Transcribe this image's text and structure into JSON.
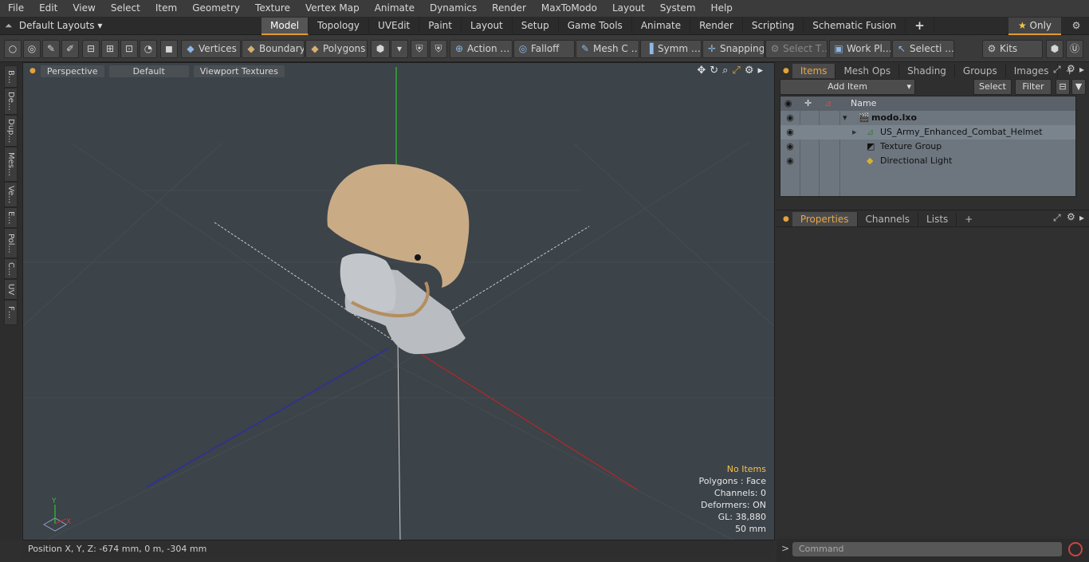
{
  "menu": [
    "File",
    "Edit",
    "View",
    "Select",
    "Item",
    "Geometry",
    "Texture",
    "Vertex Map",
    "Animate",
    "Dynamics",
    "Render",
    "MaxToModo",
    "Layout",
    "System",
    "Help"
  ],
  "layout_selector": "Default Layouts",
  "tabs": [
    "Model",
    "Topology",
    "UVEdit",
    "Paint",
    "Layout",
    "Setup",
    "Game Tools",
    "Animate",
    "Render",
    "Scripting",
    "Schematic Fusion"
  ],
  "active_tab": "Model",
  "only_label": "Only",
  "toolbar": {
    "vertices": "Vertices",
    "boundary": "Boundary",
    "polygons": "Polygons",
    "action": "Action …",
    "falloff": "Falloff",
    "mesh": "Mesh C …",
    "symm": "Symm …",
    "snapping": "Snapping",
    "select_t": "Select T…",
    "work_plane": "Work Pl…",
    "selection": "Selecti …",
    "kits": "Kits"
  },
  "left_tabs": [
    "B…",
    "De…",
    "Dup…",
    "Mes…",
    "Ve…",
    "E…",
    "Pol…",
    "C…",
    "UV",
    "F…"
  ],
  "viewport": {
    "view_mode": "Perspective",
    "shading": "Default",
    "textures": "Viewport Textures",
    "info": {
      "no_items": "No Items",
      "polygons": "Polygons : Face",
      "channels": "Channels: 0",
      "deformers": "Deformers: ON",
      "gl": "GL: 38,880",
      "focal": "50 mm"
    },
    "axis_labels": {
      "y": "Y",
      "x": "X"
    }
  },
  "status": "Position X, Y, Z:   -674 mm, 0 m, -304 mm",
  "items_panel": {
    "tabs": [
      "Items",
      "Mesh Ops",
      "Shading",
      "Groups",
      "Images"
    ],
    "active": "Items",
    "add_item": "Add Item",
    "select": "Select",
    "filter": "Filter",
    "name_header": "Name",
    "rows": [
      "modo.lxo",
      "US_Army_Enhanced_Combat_Helmet",
      "Texture Group",
      "Directional Light"
    ]
  },
  "props_panel": {
    "tabs": [
      "Properties",
      "Channels",
      "Lists"
    ],
    "active": "Properties"
  },
  "command_placeholder": "Command",
  "colors": {
    "accent": "#e39a2c",
    "viewport_bg": "#3c4349",
    "helmet": "#c9ab85",
    "bust": "#b9bcc0"
  }
}
